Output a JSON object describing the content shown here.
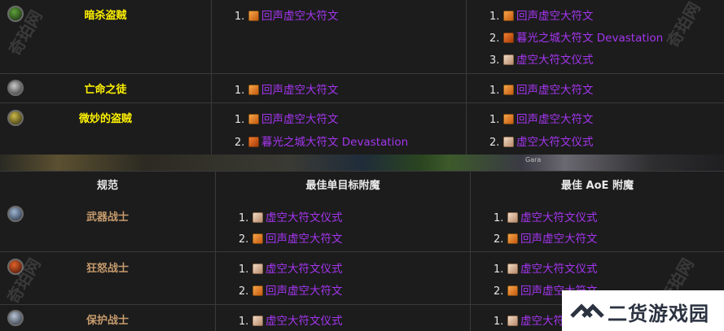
{
  "top_section": {
    "rows": [
      {
        "spec": "暗杀盗贼",
        "icon": "crossed-daggers-icon",
        "single": [
          {
            "num": "1.",
            "icon": "orange",
            "text": "回声虚空大符文"
          }
        ],
        "aoe": [
          {
            "num": "1.",
            "icon": "orange",
            "text": "回声虚空大符文"
          },
          {
            "num": "2.",
            "icon": "orange2",
            "text": "暮光之城大符文 Devastation"
          },
          {
            "num": "3.",
            "icon": "pale",
            "text": "虚空大符文仪式"
          }
        ]
      },
      {
        "spec": "亡命之徒",
        "icon": "pirate-icon",
        "single": [
          {
            "num": "1.",
            "icon": "orange",
            "text": "回声虚空大符文"
          }
        ],
        "aoe": [
          {
            "num": "1.",
            "icon": "orange",
            "text": "回声虚空大符文"
          }
        ]
      },
      {
        "spec": "微妙的盗贼",
        "icon": "subtlety-icon",
        "single": [
          {
            "num": "1.",
            "icon": "orange",
            "text": "回声虚空大符文"
          },
          {
            "num": "2.",
            "icon": "orange2",
            "text": "暮光之城大符文 Devastation"
          }
        ],
        "aoe": [
          {
            "num": "1.",
            "icon": "orange",
            "text": "回声虚空大符文"
          },
          {
            "num": "2.",
            "icon": "pale",
            "text": "虚空大符文仪式"
          }
        ]
      }
    ]
  },
  "strip": {
    "text": "Gara"
  },
  "bottom_section": {
    "headers": {
      "spec": "规范",
      "single": "最佳单目标附魔",
      "aoe": "最佳 AoE 附魔"
    },
    "rows": [
      {
        "spec": "武器战士",
        "icon": "arms-warrior-icon",
        "single": [
          {
            "num": "1.",
            "icon": "pale",
            "text": "虚空大符文仪式"
          },
          {
            "num": "2.",
            "icon": "orange",
            "text": "回声虚空大符文"
          }
        ],
        "aoe": [
          {
            "num": "1.",
            "icon": "pale",
            "text": "虚空大符文仪式"
          },
          {
            "num": "2.",
            "icon": "orange",
            "text": "回声虚空大符文"
          }
        ]
      },
      {
        "spec": "狂怒战士",
        "icon": "fury-warrior-icon",
        "single": [
          {
            "num": "1.",
            "icon": "pale",
            "text": "虚空大符文仪式"
          },
          {
            "num": "2.",
            "icon": "orange",
            "text": "回声虚空大符文"
          }
        ],
        "aoe": [
          {
            "num": "1.",
            "icon": "pale",
            "text": "虚空大符文仪式"
          },
          {
            "num": "2.",
            "icon": "orange",
            "text": "回声虚空大符文"
          }
        ]
      },
      {
        "spec": "保护战士",
        "icon": "protection-warrior-icon",
        "single": [
          {
            "num": "1.",
            "icon": "pale",
            "text": "虚空大符文仪式"
          }
        ],
        "aoe": [
          {
            "num": "1.",
            "icon": "pale",
            "text": "虚空大符文仪式"
          }
        ]
      }
    ]
  },
  "watermarks": [
    "奇珀网",
    "奇珀网",
    "奇珀网",
    "奇珀网"
  ],
  "banner": {
    "text": "二货游戏园",
    "icon": "double-chevron-logo-icon"
  },
  "colors": {
    "rogue": "#fff200",
    "warrior": "#c69b6d",
    "enchant": "#a335ee",
    "border": "#3a3a3a"
  }
}
